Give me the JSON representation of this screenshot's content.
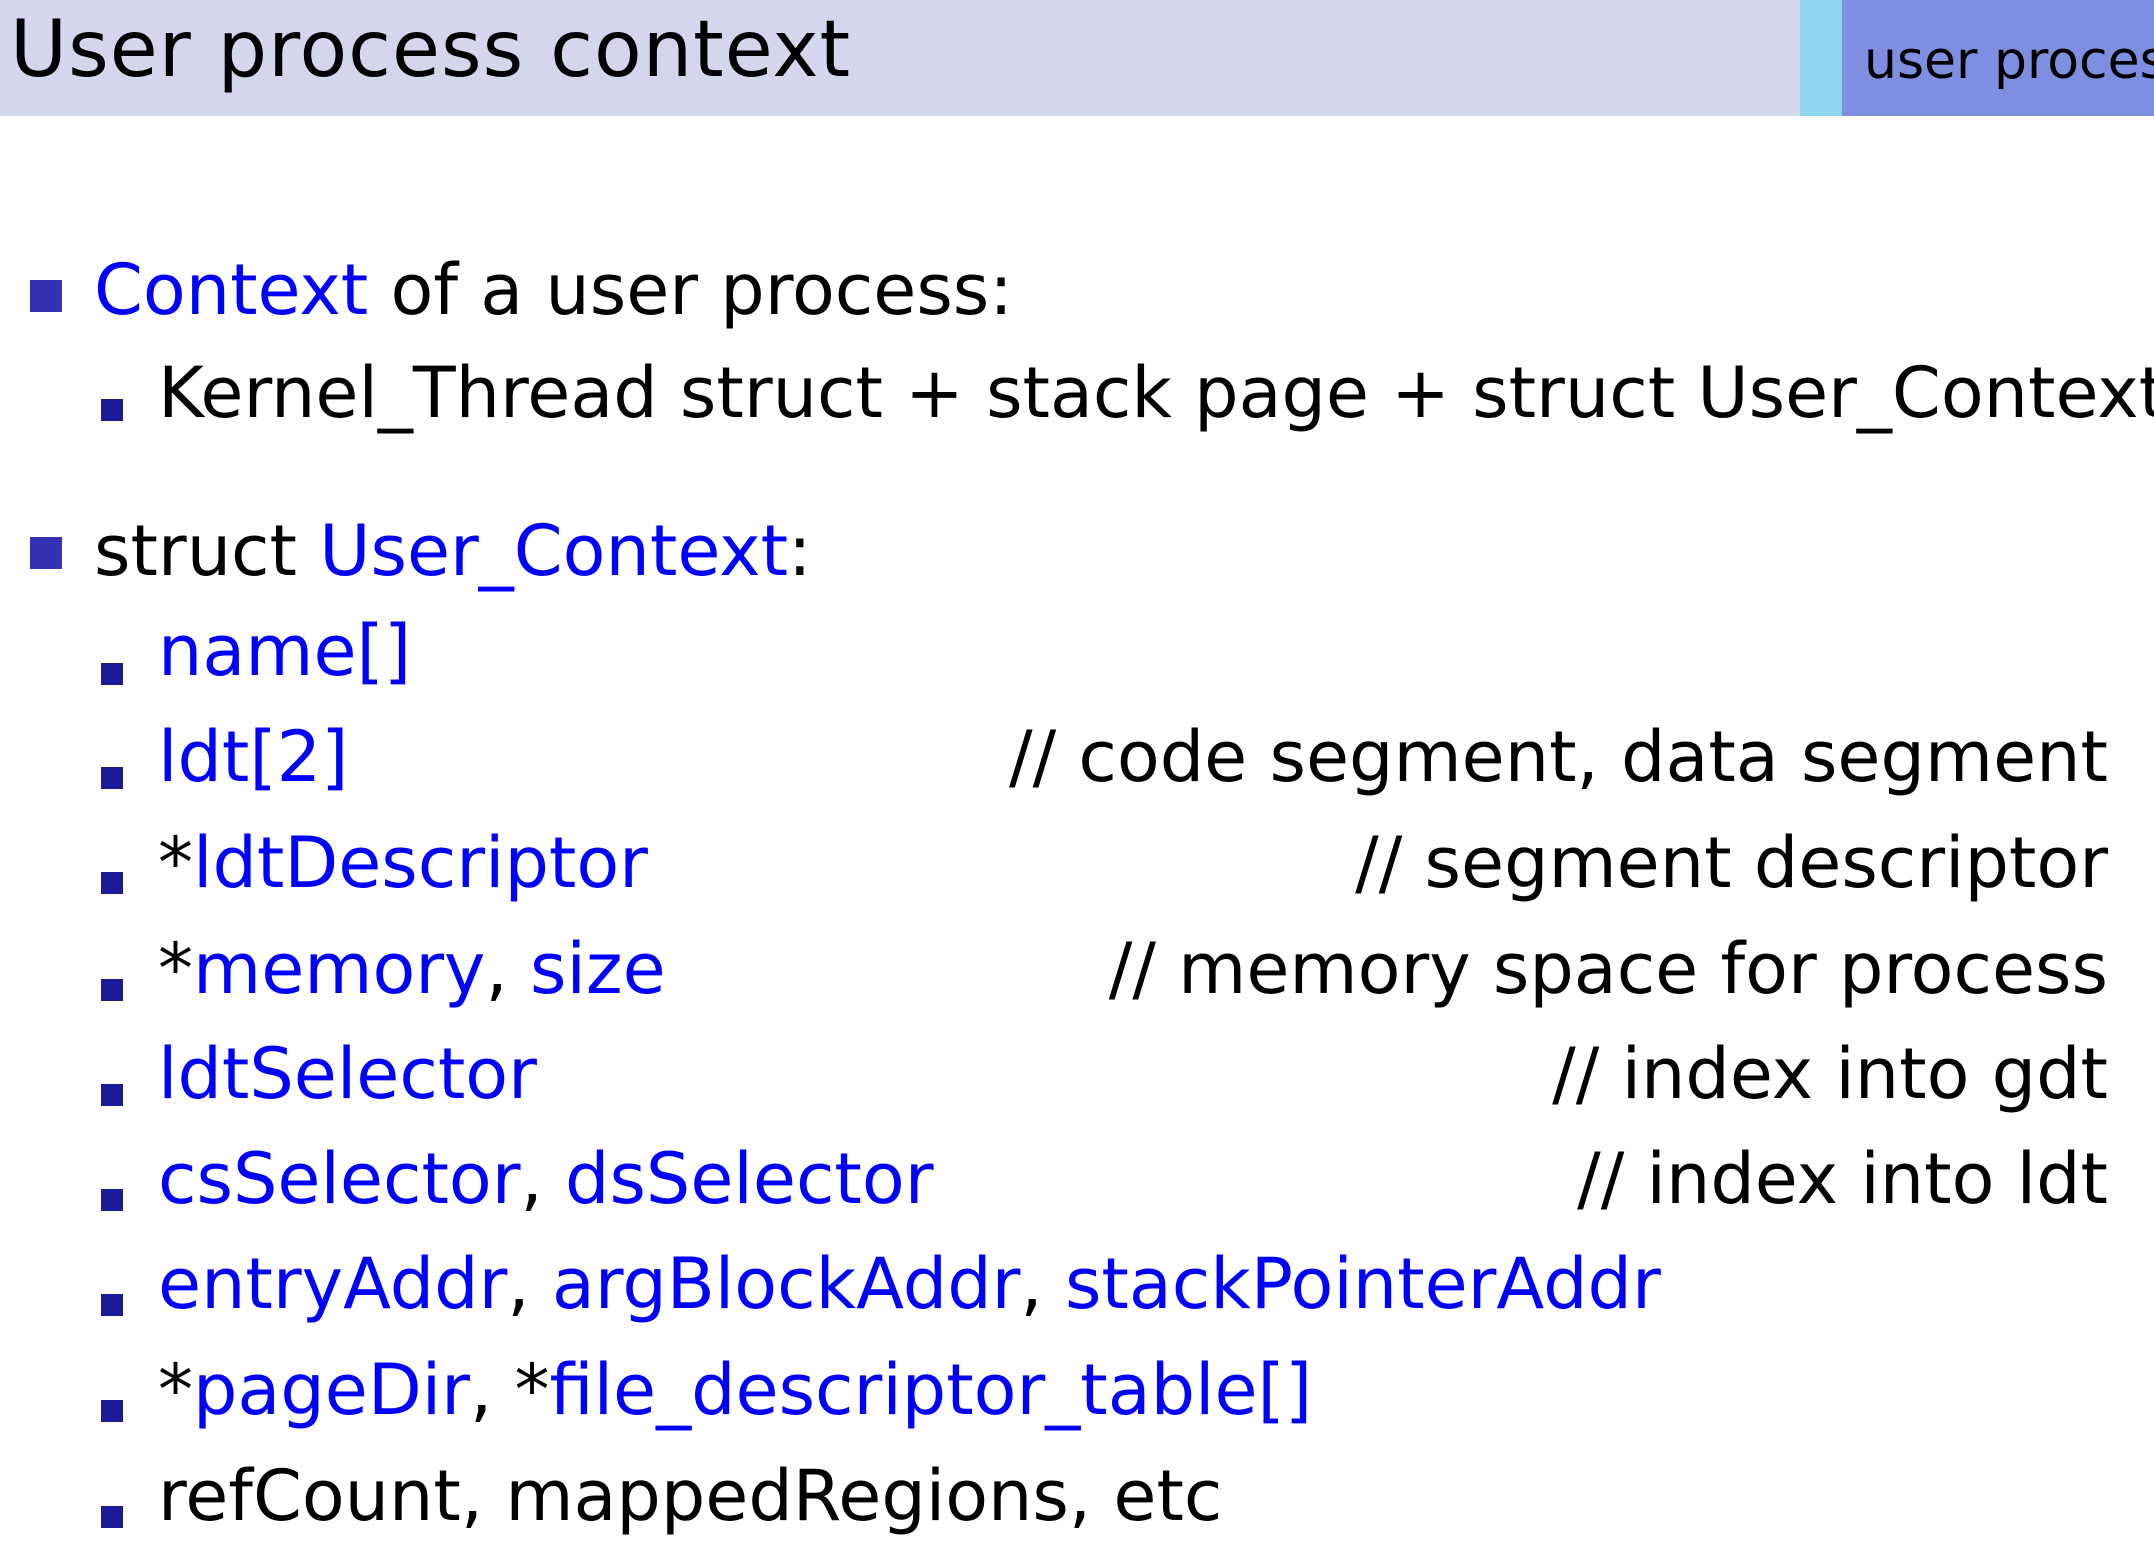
{
  "header": {
    "title": "User process context",
    "section_label": "user process"
  },
  "colors": {
    "header_bg": "#d3d6ec",
    "accent_cyan": "#8ed8ef",
    "accent_tab": "#7e8ee0",
    "keyword_blue": "#0000ff",
    "bullet_blue": "#3333b2"
  },
  "bullets": {
    "b1": {
      "keyword": "Context",
      "rest": " of a user process:"
    },
    "b1_1": {
      "text": "Kernel_Thread struct + stack page + struct User_Context"
    },
    "b2": {
      "prefix": "struct ",
      "keyword": "User_Context",
      "suffix": ":"
    },
    "fields": {
      "f1": {
        "name": "name[]"
      },
      "f2": {
        "name": "ldt[2]",
        "comment": "// code segment, data segment"
      },
      "f3": {
        "star": "*",
        "name": "ldtDescriptor",
        "comment": "// segment descriptor"
      },
      "f4": {
        "star": "*",
        "name": "memory",
        "sep": ", ",
        "name2": "size",
        "comment": "// memory space for process"
      },
      "f5": {
        "name": "ldtSelector",
        "comment": "// index into gdt"
      },
      "f6": {
        "name": "csSelector",
        "sep": ", ",
        "name2": "dsSelector",
        "comment": "// index into ldt"
      },
      "f7": {
        "name": "entryAddr",
        "sep": ", ",
        "name2": "argBlockAddr",
        "sep2": ", ",
        "name3": "stackPointerAddr"
      },
      "f8": {
        "star": "*",
        "name": "pageDir",
        "sep": ", *",
        "name2": "file_descriptor_table[]"
      },
      "f9": {
        "text": "refCount, mappedRegions, etc"
      }
    }
  }
}
